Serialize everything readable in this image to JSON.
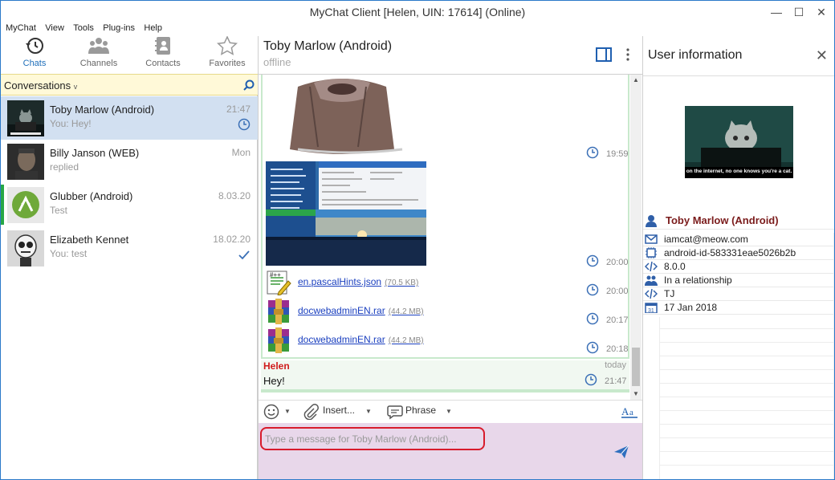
{
  "window": {
    "title": "MyChat Client [Helen, UIN: 17614] (Online)"
  },
  "menu": [
    "MyChat",
    "View",
    "Tools",
    "Plug-ins",
    "Help"
  ],
  "nav": {
    "tabs": [
      {
        "label": "Chats",
        "icon": "history-icon",
        "active": true
      },
      {
        "label": "Channels",
        "icon": "group-icon",
        "active": false
      },
      {
        "label": "Contacts",
        "icon": "address-book-icon",
        "active": false
      },
      {
        "label": "Favorites",
        "icon": "star-icon",
        "active": false
      }
    ]
  },
  "conversations": {
    "title": "Conversations",
    "items": [
      {
        "name": "Toby Marlow (Android)",
        "sub": "You: Hey!",
        "time": "21:47",
        "status": "pending"
      },
      {
        "name": "Billy Janson (WEB)",
        "sub": "replied",
        "time": "Mon",
        "status": ""
      },
      {
        "name": "Glubber (Android)",
        "sub": "Test",
        "time": "8.03.20",
        "status": ""
      },
      {
        "name": "Elizabeth Kennet",
        "sub": "You: test",
        "time": "18.02.20",
        "status": "delivered"
      }
    ]
  },
  "chat": {
    "name": "Toby Marlow (Android)",
    "status": "offline",
    "messages": [
      {
        "type": "image",
        "time": "19:59"
      },
      {
        "type": "image",
        "time": "20:00"
      },
      {
        "type": "file",
        "name": "en.pascalHints.json",
        "size": "(70.5 KB)",
        "time": "20:00"
      },
      {
        "type": "file",
        "name": "docwebadminEN.rar",
        "size": "(44.2 MB)",
        "time": "20:17"
      },
      {
        "type": "file",
        "name": "docwebadminEN.rar",
        "size": "(44.2 MB)",
        "time": "20:18"
      }
    ],
    "last": {
      "sender": "Helen",
      "day": "today",
      "text": "Hey!",
      "time": "21:47"
    }
  },
  "toolbar": {
    "insert": "Insert...",
    "phrase": "Phrase"
  },
  "input": {
    "placeholder": "Type a message for Toby Marlow (Android)..."
  },
  "userinfo": {
    "title": "User information",
    "photo_caption": "on the internet, no one knows you're a cat.",
    "name": "Toby Marlow (Android)",
    "email": "iamcat@meow.com",
    "device": "android-id-583331eae5026b2b",
    "version": "8.0.0",
    "relationship": "In a relationship",
    "code": "TJ",
    "birthday": "17 Jan 2018"
  }
}
